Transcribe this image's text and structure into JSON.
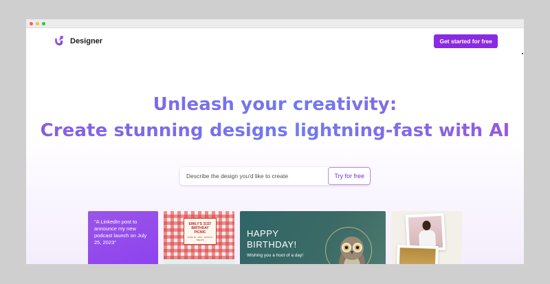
{
  "app": {
    "brand_name": "Designer"
  },
  "header": {
    "cta_label": "Get started for free"
  },
  "hero": {
    "line1": "Unleash your creativity:",
    "line2": "Create stunning designs lightning-fast with AI"
  },
  "search": {
    "placeholder": "Describe the design you'd like to create",
    "button_label": "Try for free"
  },
  "gallery": {
    "prompt_card_text": "\"A LinkedIn post to announce my new podcast launch on July 25, 2023\"",
    "picnic_title": "EMILY'S 31ST BIRTHDAY PICNIC",
    "picnic_sub": "JUNE 18 · 1PM · TACOS & TREATS",
    "birthday_title": "HAPPY BIRTHDAY!",
    "birthday_sub": "Wishing you a hoot of a day!"
  },
  "colors": {
    "accent": "#8a2be2",
    "hero_gradient_start": "#8a5bdf",
    "hero_gradient_end": "#6f7bf0"
  },
  "icons": {
    "brand_logo": "designer-logo-icon",
    "window_controls": [
      "close-dot-icon",
      "minimize-dot-icon",
      "maximize-dot-icon"
    ]
  }
}
